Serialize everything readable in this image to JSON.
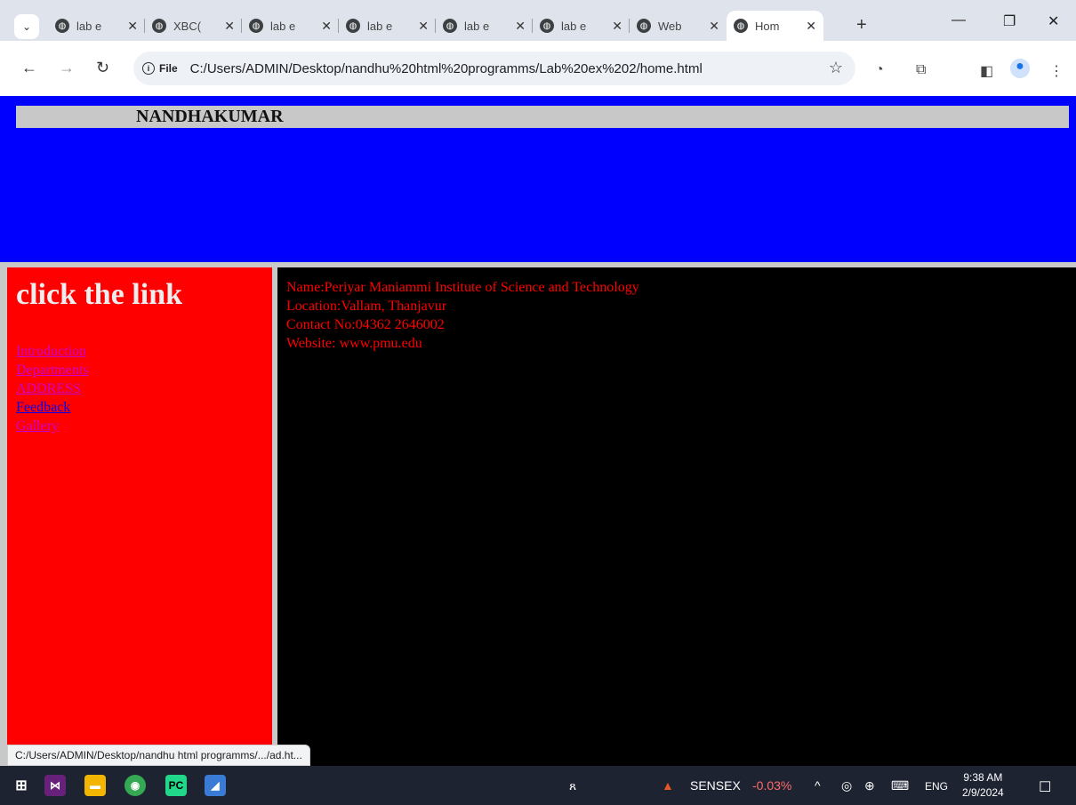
{
  "browser": {
    "tabs": [
      {
        "title": "lab e"
      },
      {
        "title": "XBC("
      },
      {
        "title": "lab e"
      },
      {
        "title": "lab e"
      },
      {
        "title": "lab e"
      },
      {
        "title": "lab e"
      },
      {
        "title": "Web"
      },
      {
        "title": "Hom",
        "active": true
      }
    ],
    "new_tab_label": "+",
    "url_chip": "File",
    "url": "C:/Users/ADMIN/Desktop/nandhu%20html%20programms/Lab%20ex%202/home.html"
  },
  "page": {
    "banner_name": "NANDHAKUMAR",
    "left": {
      "heading": "click the link",
      "links": [
        "Introduction",
        "Departments",
        "ADDRESS",
        "Feedback",
        "Gallery"
      ]
    },
    "right": {
      "lines": [
        "Name:Periyar Maniammi Institute of Science and Technology",
        "Location:Vallam, Thanjavur",
        "Contact No:04362 2646002",
        "Website: www.pmu.edu"
      ]
    },
    "colors": {
      "banner": "#0000ff",
      "left": "#ff0000",
      "right": "#000000",
      "text": "#ff0000"
    }
  },
  "status_url": "C:/Users/ADMIN/Desktop/nandhu html programms/.../ad.ht...",
  "taskbar": {
    "sensex_label": "SENSEX",
    "sensex_value": "-0.03%",
    "lang": "ENG",
    "time": "9:38 AM",
    "date": "2/9/2024"
  }
}
